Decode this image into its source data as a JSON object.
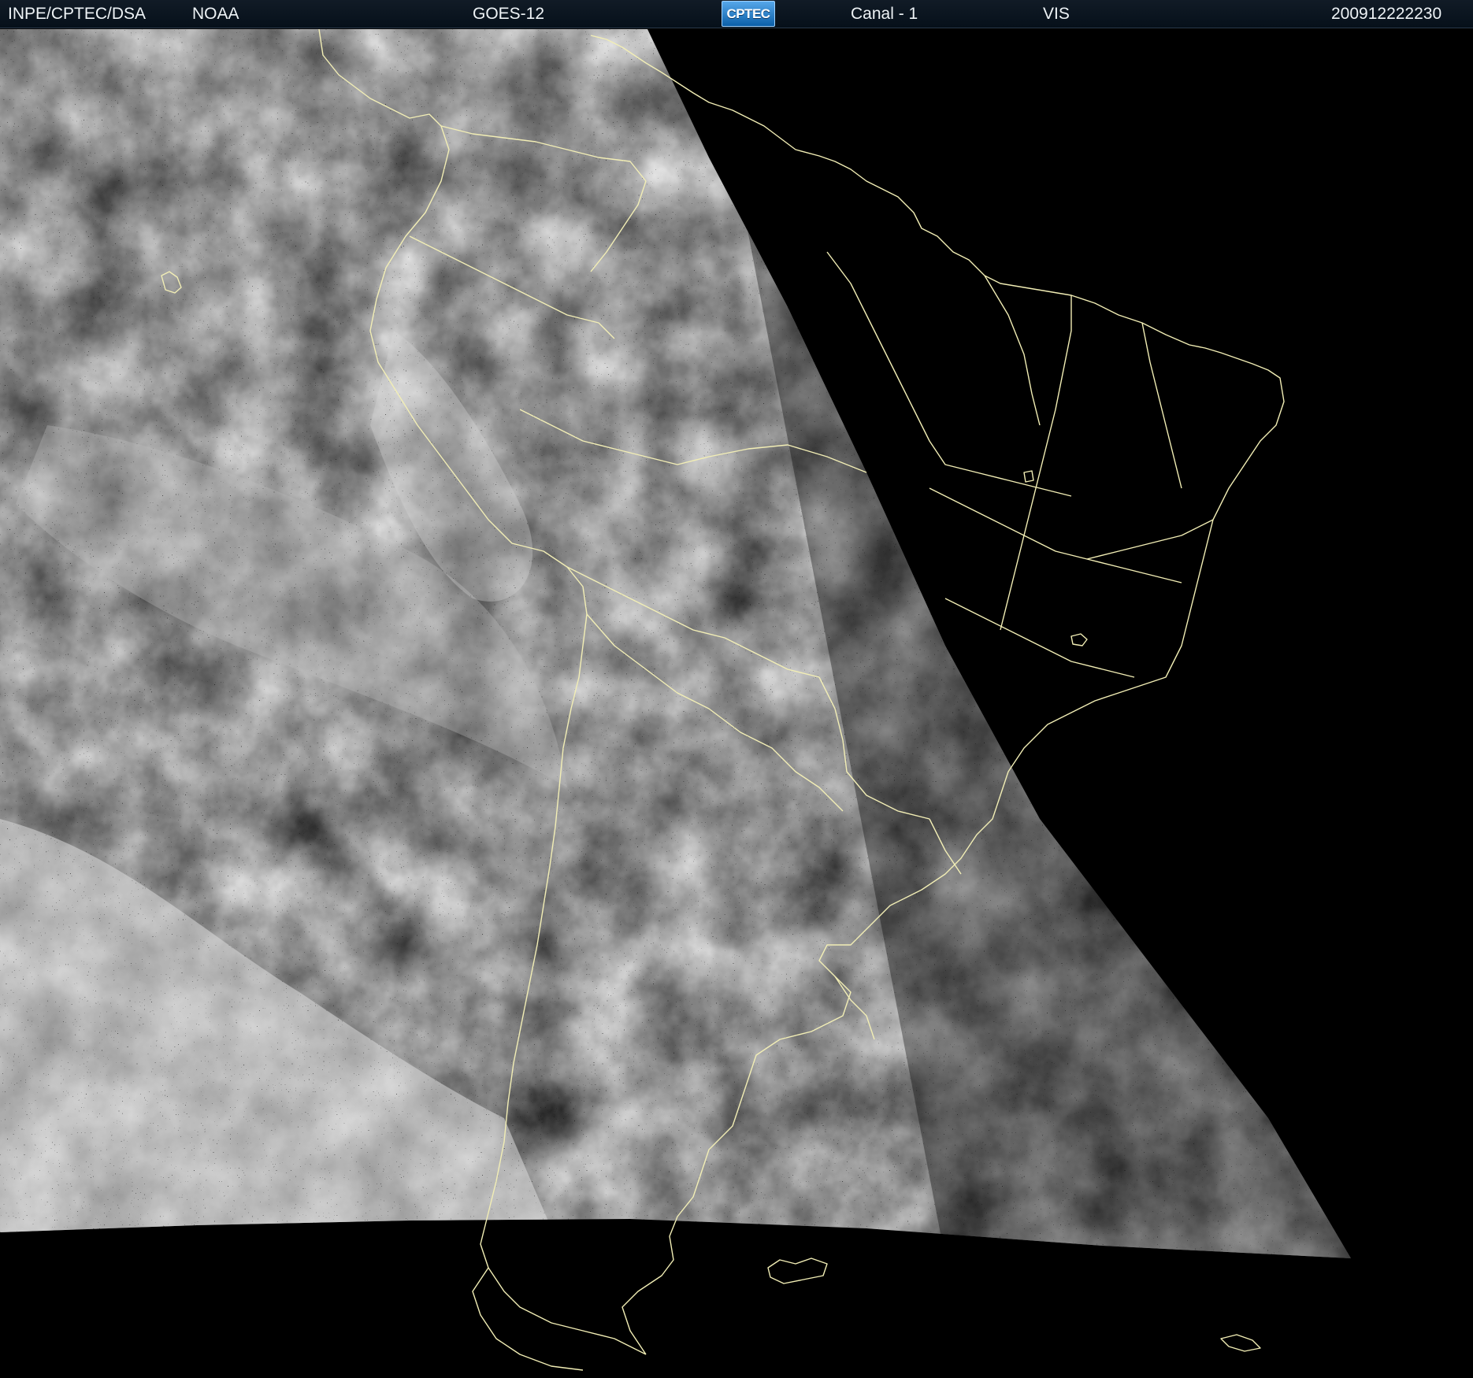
{
  "header": {
    "source": "INPE/CPTEC/DSA",
    "agency": "NOAA",
    "satellite": "GOES-12",
    "logo_text": "CPTEC",
    "channel": "Canal - 1",
    "band": "VIS",
    "timestamp": "200912222230"
  },
  "colors": {
    "background": "#000000",
    "header_bg": "#0b1520",
    "header_text": "#eef3f6",
    "coastline": "#f2eeb5",
    "cloud_bright": "#f0f0f0",
    "cloud_dim": "#6d6d6d"
  },
  "scene": {
    "description_visible": "grayscale visible-channel satellite imagery over South America with yellow coastlines and political borders"
  }
}
